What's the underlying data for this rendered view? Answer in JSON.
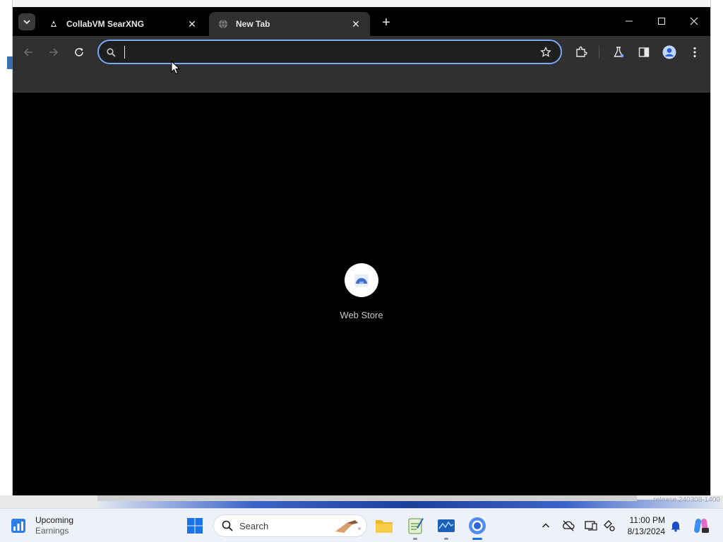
{
  "browser": {
    "tabs": [
      {
        "title": "CollabVM SearXNG",
        "active": false
      },
      {
        "title": "New Tab",
        "active": true
      }
    ],
    "omnibox": {
      "value": "",
      "placeholder": ""
    },
    "accent_color": "#7ca6f8",
    "toolbar_color": "#303030",
    "icons": [
      "back-arrow-icon",
      "forward-arrow-icon",
      "reload-icon",
      "search-icon",
      "star-icon",
      "extensions-icon",
      "labs-icon",
      "side-panel-icon",
      "profile-icon",
      "more-menu-icon"
    ]
  },
  "content": {
    "shortcuts": [
      {
        "label": "Web Store"
      }
    ]
  },
  "desktop": {
    "watermark": "_release.240308-1400"
  },
  "taskbar": {
    "widget": {
      "title": "Upcoming",
      "subtitle": "Earnings"
    },
    "search_label": "Search",
    "clock": {
      "time": "11:00 PM",
      "date": "8/13/2024"
    },
    "apps": [
      "file-explorer-icon",
      "notepad-icon",
      "task-monitor-icon",
      "chrome-icon"
    ]
  }
}
